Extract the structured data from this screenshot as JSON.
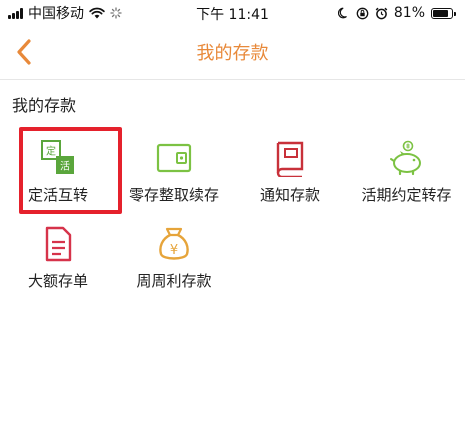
{
  "status_bar": {
    "carrier": "中国移动",
    "time": "下午 11:41",
    "battery_text": "81%",
    "battery_level": 0.81
  },
  "nav": {
    "title": "我的存款"
  },
  "section": {
    "title": "我的存款"
  },
  "products": [
    {
      "label": "定活互转",
      "icon": "fixed-current-swap-icon",
      "icon_text_top": "定",
      "icon_text_bottom": "活",
      "color": "#5aa63c"
    },
    {
      "label": "零存整取续存",
      "icon": "wallet-icon",
      "color": "#7cc243"
    },
    {
      "label": "通知存款",
      "icon": "book-icon",
      "color": "#c8313a"
    },
    {
      "label": "活期约定转存",
      "icon": "piggy-bank-icon",
      "color": "#7cc243"
    },
    {
      "label": "大额存单",
      "icon": "document-icon",
      "color": "#d6334a"
    },
    {
      "label": "周周利存款",
      "icon": "money-bag-icon",
      "icon_text": "¥",
      "color": "#e6a43a"
    }
  ],
  "colors": {
    "accent": "#e8893a",
    "highlight": "#e5212c"
  }
}
